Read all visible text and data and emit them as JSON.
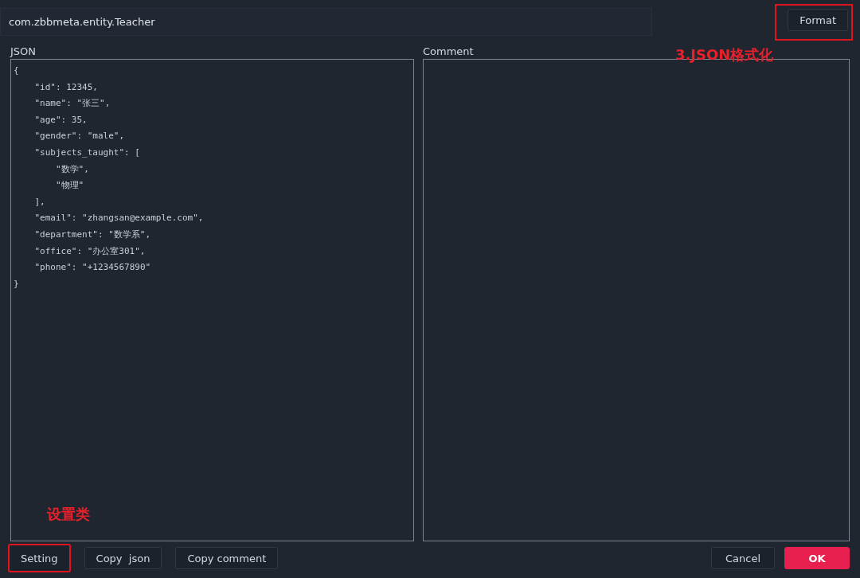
{
  "class_field": {
    "value": "com.zbbmeta.entity.Teacher"
  },
  "format_button": {
    "label": "Format",
    "highlighted": true
  },
  "json_panel": {
    "label": "JSON",
    "text": "{\n    \"id\": 12345,\n    \"name\": \"张三\",\n    \"age\": 35,\n    \"gender\": \"male\",\n    \"subjects_taught\": [\n        \"数学\",\n        \"物理\"\n    ],\n    \"email\": \"zhangsan@example.com\",\n    \"department\": \"数学系\",\n    \"office\": \"办公室301\",\n    \"phone\": \"+1234567890\"\n}"
  },
  "comment_panel": {
    "label": "Comment"
  },
  "annotations": [
    {
      "text": "3.JSON格式化",
      "kind": "format"
    },
    {
      "text": "设置类",
      "kind": "setting"
    }
  ],
  "left_buttons": [
    {
      "label": "Setting",
      "highlighted": true
    },
    {
      "label": "Copy  json",
      "highlighted": false
    },
    {
      "label": "Copy comment",
      "highlighted": false
    }
  ],
  "right_buttons": [
    {
      "label": "Cancel",
      "kind": "secondary"
    },
    {
      "label": "OK",
      "kind": "primary"
    }
  ]
}
